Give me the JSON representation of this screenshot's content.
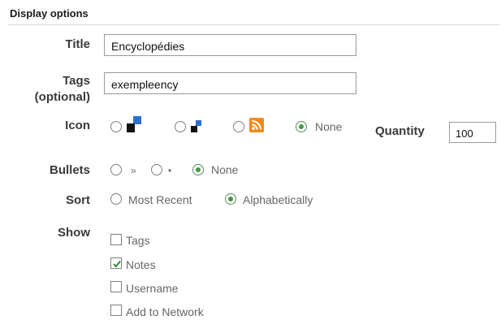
{
  "section": {
    "heading": "Display options"
  },
  "title": {
    "label": "Title",
    "value": "Encyclopédies"
  },
  "tags": {
    "label_line1": "Tags",
    "label_line2": "(optional)",
    "value": "exempleency"
  },
  "icon": {
    "label": "Icon",
    "options": [
      {
        "icon": "large-squares-icon",
        "checked": false
      },
      {
        "icon": "small-squares-icon",
        "checked": false
      },
      {
        "icon": "rss-icon",
        "checked": false
      },
      {
        "label": "None",
        "checked": true
      }
    ]
  },
  "quantity": {
    "label": "Quantity",
    "value": "100"
  },
  "bullets": {
    "label": "Bullets",
    "options": [
      {
        "glyph": "»",
        "checked": false
      },
      {
        "glyph": "•",
        "checked": false
      },
      {
        "label": "None",
        "checked": true
      }
    ]
  },
  "sort": {
    "label": "Sort",
    "options": [
      {
        "label": "Most Recent",
        "checked": false
      },
      {
        "label": "Alphabetically",
        "checked": true
      }
    ]
  },
  "show": {
    "label": "Show",
    "items": [
      {
        "label": "Tags",
        "checked": false
      },
      {
        "label": "Notes",
        "checked": true
      },
      {
        "label": "Username",
        "checked": false
      },
      {
        "label": "Add to Network",
        "checked": false
      }
    ]
  },
  "colors": {
    "rss": "#f38a1c",
    "radio_dot": "#3e9a3e",
    "check_mark": "#2e8b2e"
  }
}
